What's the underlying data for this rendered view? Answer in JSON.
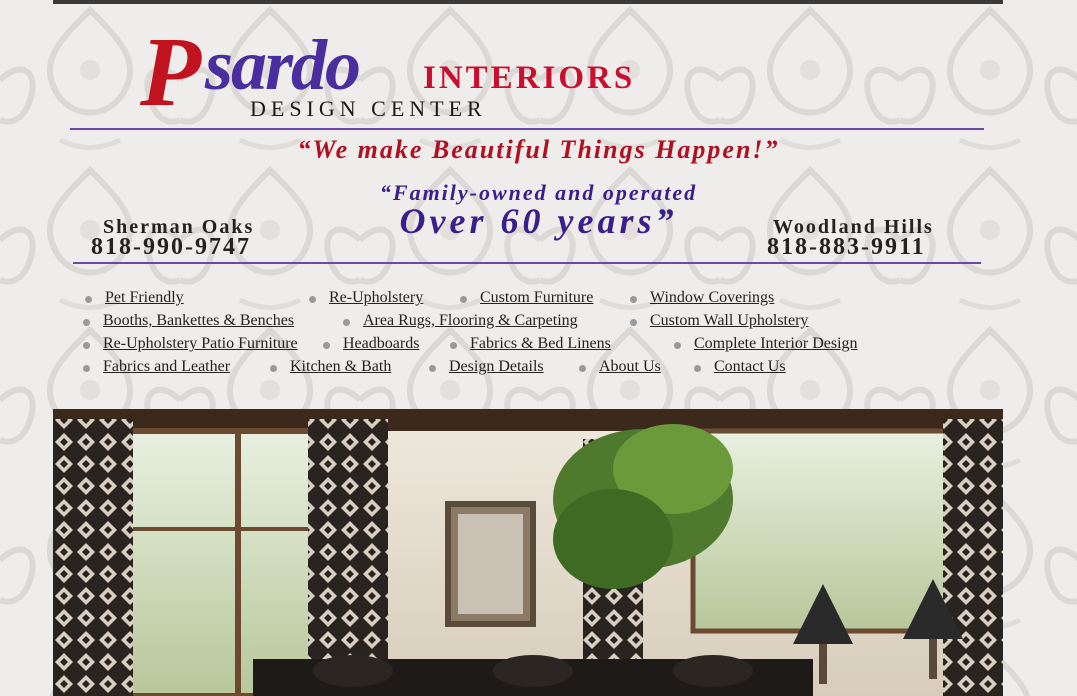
{
  "brand": {
    "logo_initial": "P",
    "logo_script": "sardo",
    "interiors": "INTERIORS",
    "design_center": "DESIGN CENTER"
  },
  "tagline": "“We make Beautiful Things Happen!”",
  "family_line": "“Family-owned and operated",
  "years_line": "Over 60 years”",
  "locations": {
    "left": {
      "name": "Sherman Oaks",
      "phone": "818-990-9747"
    },
    "right": {
      "name": "Woodland Hills",
      "phone": "818-883-9911"
    }
  },
  "nav": {
    "items": [
      "Pet Friendly",
      "Re-Upholstery",
      "Custom Furniture",
      "Window Coverings",
      "Booths, Bankettes & Benches",
      "Area Rugs, Flooring & Carpeting",
      "Custom Wall Upholstery",
      "Re-Upholstery Patio Furniture",
      "Headboards",
      "Fabrics & Bed Linens",
      "Complete Interior Design",
      "Fabrics and Leather",
      "Kitchen & Bath",
      "Design Details",
      "About Us",
      "Contact Us"
    ]
  },
  "colors": {
    "brand_purple": "#4a2ea0",
    "brand_red": "#c8102e",
    "divider": "#6a4aa8"
  }
}
